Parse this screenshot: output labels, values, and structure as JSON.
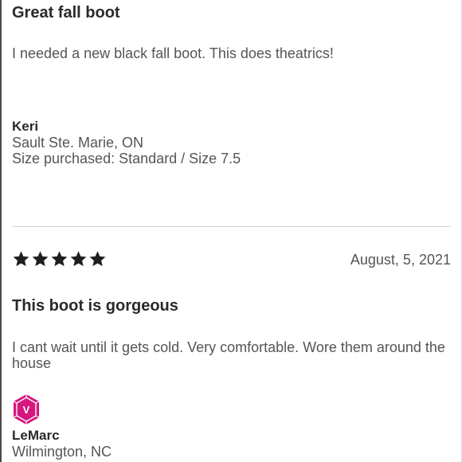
{
  "reviews": [
    {
      "title": "Great fall boot",
      "body": "I needed a new black fall boot. This does theatrics!",
      "reviewer": {
        "name": "Keri",
        "location": "Sault Ste. Marie, ON",
        "size": "Size purchased: Standard / Size 7.5"
      }
    },
    {
      "rating": 5,
      "date": "August, 5, 2021",
      "title": "This boot is gorgeous",
      "body": "I cant wait until it gets cold. Very comfortable. Wore them around the house",
      "reviewer": {
        "name": "LeMarc",
        "location": "Wilmington, NC",
        "badge_icon": "verified-buyer-badge-icon",
        "badge_letter": "V",
        "badge_color": "#d6177f"
      }
    }
  ],
  "colors": {
    "text_dark": "#2a2a2a",
    "text_muted": "#555555",
    "star": "#1f1f1f",
    "divider": "#d4d4d4"
  }
}
